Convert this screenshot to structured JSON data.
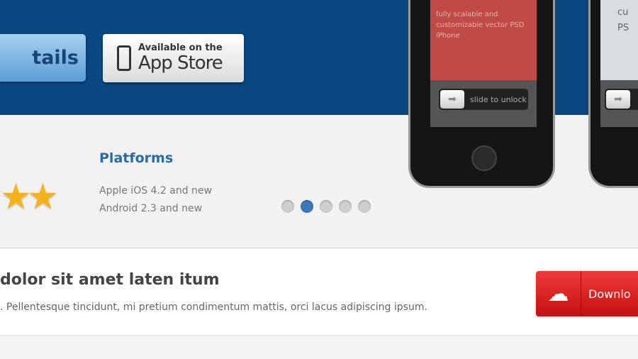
{
  "hero": {
    "details_label": "tails",
    "appstore_small": "Available on the",
    "appstore_big": "App Store"
  },
  "phones": [
    {
      "screen_text": "fully scalable and customizable vector PSD iPhone",
      "unlock_label": "slide to unlock"
    },
    {
      "screen_text": "ful cu PS",
      "unlock_label": ""
    }
  ],
  "platforms": {
    "title": "Platforms",
    "lines": [
      "Apple iOS 4.2 and new",
      "Android 2.3 and new"
    ]
  },
  "carousel": {
    "dot_count": 5,
    "active_index": 1
  },
  "cta": {
    "title": "dolor sit amet laten itum",
    "text": ". Pellentesque tincidunt, mi pretium condimentum mattis, orci lacus adipiscing ipsum.",
    "download_label": "Downlo"
  },
  "colors": {
    "hero_bg": "#0a467f",
    "accent": "#2a6aa6",
    "download": "#e02020"
  }
}
